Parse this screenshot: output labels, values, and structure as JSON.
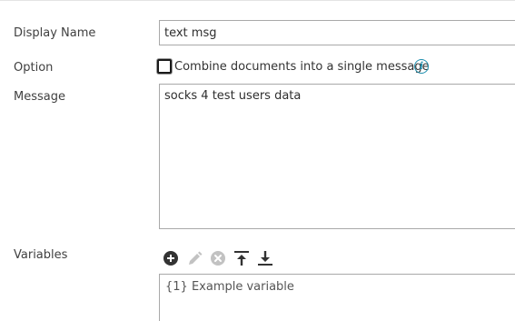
{
  "form": {
    "display_name": {
      "label": "Display Name",
      "value": "text msg"
    },
    "option": {
      "label": "Option",
      "checkbox_label": "Combine documents into a single message",
      "checked": false,
      "info_icon": "info-icon"
    },
    "message": {
      "label": "Message",
      "value": "socks 4 test users data"
    },
    "variables": {
      "label": "Variables",
      "toolbar": {
        "add": "add-circle-icon",
        "edit": "pencil-icon",
        "delete": "remove-circle-icon",
        "move_to_top": "move-to-top-icon",
        "move_to_bottom": "move-to-bottom-icon"
      },
      "items": [
        "{1} Example variable"
      ]
    }
  },
  "colors": {
    "border": "#a9a9a9",
    "info": "#1f8fae",
    "icon_active": "#333333",
    "icon_disabled": "#c2c2c2"
  }
}
